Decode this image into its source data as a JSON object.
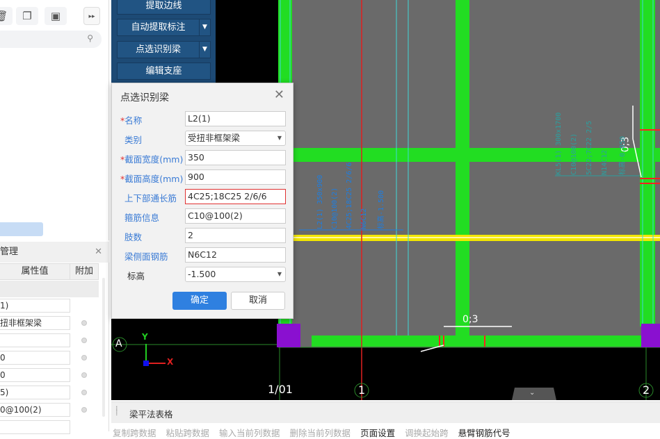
{
  "left_panel": {
    "search_icon": "search-icon",
    "toolbar_icons": [
      "delete-icon",
      "copy-icon",
      "save-as-icon",
      "expand-icon"
    ],
    "expand_glyph": "▸▸"
  },
  "props_panel": {
    "title": "管理",
    "col_value": "属性值",
    "col_extra": "附加",
    "rows": [
      "1)",
      "扭非框架梁",
      "",
      "0",
      "0",
      "5)",
      "0@100(2)",
      ""
    ]
  },
  "tool_buttons": {
    "extract_edge": "提取边线",
    "auto_extract_label": "自动提取标注",
    "pick_beam": "点选识别梁",
    "edit_support": "编辑支座"
  },
  "dialog": {
    "title": "点选识别梁",
    "fields": [
      {
        "label": "名称",
        "required": true,
        "value": "L2(1)"
      },
      {
        "label": "类别",
        "required": false,
        "value": "受扭非框架梁",
        "dropdown": true
      },
      {
        "label": "截面宽度(mm)",
        "required": true,
        "value": "350"
      },
      {
        "label": "截面高度(mm)",
        "required": true,
        "value": "900"
      },
      {
        "label": "上下部通长筋",
        "required": false,
        "value": "4C25;18C25 2/6/6",
        "error": true
      },
      {
        "label": "箍筋信息",
        "required": false,
        "value": "C10@100(2)"
      },
      {
        "label": "肢数",
        "required": false,
        "value": "2"
      },
      {
        "label": "梁侧面钢筋",
        "required": false,
        "value": "N6C12"
      },
      {
        "label": "标高",
        "required": false,
        "value": "-1.500",
        "dropdown": true
      }
    ],
    "ok": "确定",
    "cancel": "取消"
  },
  "cad": {
    "axis_labels": {
      "a": "A",
      "one_01": "1/01",
      "one": "1",
      "two": "2"
    },
    "beam_label_left": [
      "L2(1) 350x900",
      "C10@100(2)",
      "4C25;18C25 2/6/6",
      "N6C12",
      "标高-1.500"
    ],
    "beam_label_right": [
      "KL5(1) 300x1700",
      "C10@100(2)",
      "5C22;7C22 2/5",
      "N14C12",
      "标高-0.050"
    ],
    "dim_bottom": "0;3",
    "dim_right": "0;3",
    "ucs_x": "X",
    "ucs_y": "Y"
  },
  "bottom_panel": {
    "title": "梁平法表格",
    "tools": [
      {
        "label": "复制跨数据",
        "enabled": false
      },
      {
        "label": "粘贴跨数据",
        "enabled": false
      },
      {
        "label": "输入当前列数据",
        "enabled": false
      },
      {
        "label": "删除当前列数据",
        "enabled": false
      },
      {
        "label": "页面设置",
        "enabled": true
      },
      {
        "label": "调换起始跨",
        "enabled": false
      },
      {
        "label": "悬臂钢筋代号",
        "enabled": true
      }
    ]
  },
  "colors": {
    "beam_green": "#22dd22",
    "accent_blue": "#2f80e0",
    "tool_panel": "#1d4a75"
  }
}
